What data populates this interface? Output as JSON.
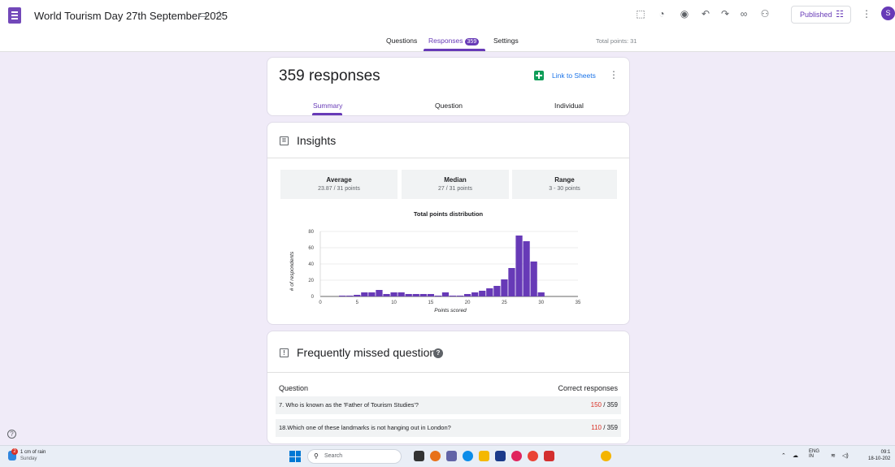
{
  "header": {
    "title": "World Tourism Day 27th September 2025",
    "tabs": [
      {
        "label": "Questions"
      },
      {
        "label": "Responses",
        "badge": "359"
      },
      {
        "label": "Settings"
      }
    ],
    "total_points": "Total points: 31",
    "published_label": "Published",
    "avatar_letter": "S",
    "icons": [
      "folder-icon",
      "star-icon",
      "customize-theme-icon",
      "palette-icon",
      "preview-icon",
      "undo-icon",
      "redo-icon",
      "link-icon",
      "add-collaborator-icon",
      "tune-icon",
      "more-vert-icon"
    ]
  },
  "responses_card": {
    "count": "359 responses",
    "link_sheets": "Link to Sheets",
    "subtabs": [
      "Summary",
      "Question",
      "Individual"
    ]
  },
  "insights": {
    "title": "Insights",
    "stats": [
      {
        "label": "Average",
        "value": "23.87 / 31 points"
      },
      {
        "label": "Median",
        "value": "27 / 31 points"
      },
      {
        "label": "Range",
        "value": "3 - 30 points"
      }
    ]
  },
  "chart_data": {
    "type": "bar",
    "title": "Total points distribution",
    "xlabel": "Points scored",
    "ylabel": "# of respondents",
    "xlim": [
      0,
      35
    ],
    "ylim": [
      0,
      80
    ],
    "xticks": [
      0,
      5,
      10,
      15,
      20,
      25,
      30,
      35
    ],
    "yticks": [
      0,
      20,
      40,
      60,
      80
    ],
    "grid": true,
    "color": "#673ab7",
    "x": [
      3,
      4,
      5,
      6,
      7,
      8,
      9,
      10,
      11,
      12,
      13,
      14,
      15,
      16,
      17,
      18,
      19,
      20,
      21,
      22,
      23,
      24,
      25,
      26,
      27,
      28,
      29,
      30
    ],
    "values": [
      1,
      1,
      2,
      5,
      5,
      8,
      3,
      5,
      5,
      3,
      3,
      3,
      3,
      1,
      5,
      1,
      1,
      3,
      5,
      7,
      10,
      13,
      21,
      35,
      75,
      68,
      43,
      5
    ]
  },
  "missed": {
    "title": "Frequently missed questions",
    "col_question": "Question",
    "col_correct": "Correct responses",
    "rows": [
      {
        "question": "7. Who is known as the 'Father of Tourism Studies'?",
        "correct": "150",
        "total": " / 359"
      },
      {
        "question": "18.Which one of these landmarks is not hanging out in London?",
        "correct": "110",
        "total": " / 359"
      }
    ]
  },
  "taskbar": {
    "weather": "1 cm of rain",
    "weather_sub": "Sunday",
    "weather_badge": "2",
    "search_placeholder": "Search",
    "lang": "ENG",
    "lang_sub": "IN",
    "time": "09:1",
    "date": "18-10-202"
  }
}
